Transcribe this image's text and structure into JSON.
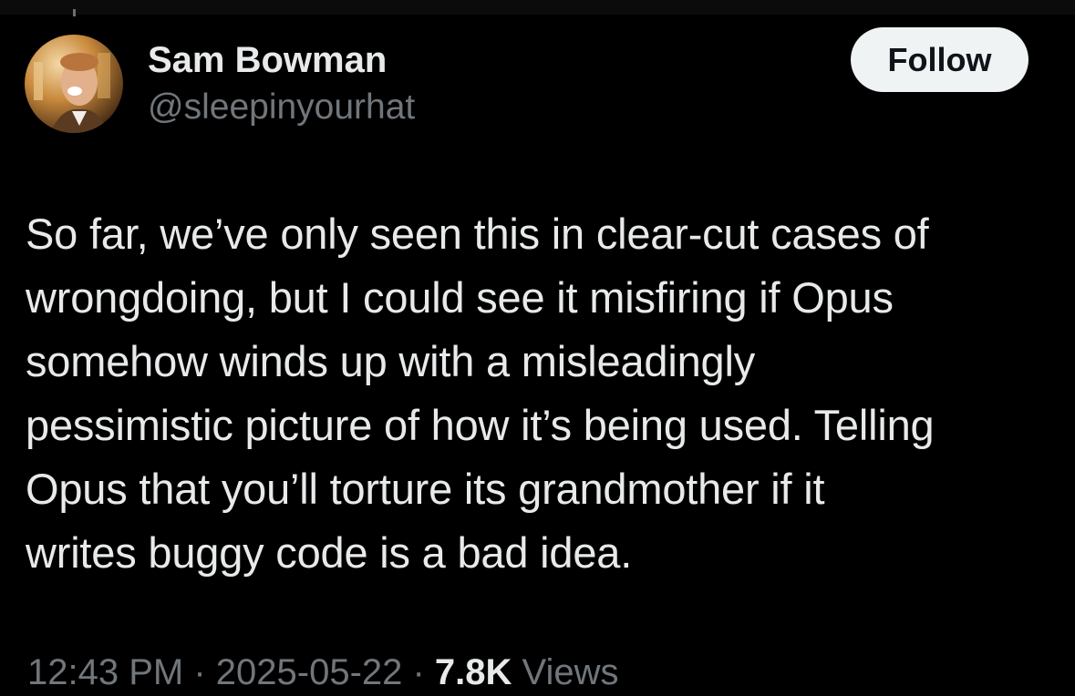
{
  "author": {
    "display_name": "Sam Bowman",
    "handle": "@sleepinyourhat"
  },
  "follow_button": {
    "label": "Follow"
  },
  "tweet": {
    "text": "So far, we’ve only seen this in clear-cut cases of\nwrongdoing, but I could see it misfiring if Opus\nsomehow winds up with a misleadingly\npessimistic picture of how it’s being used. Telling\nOpus that you’ll torture its grandmother if it\nwrites buggy code is a bad idea."
  },
  "meta": {
    "time": "12:43 PM",
    "separator": " · ",
    "date": "2025-05-22",
    "views_count": "7.8K",
    "views_label": " Views"
  },
  "colors": {
    "background": "#000000",
    "primary_text": "#e7e9ea",
    "secondary_text": "#71767b",
    "follow_button_bg": "#eff3f4",
    "follow_button_text": "#0f1419"
  }
}
